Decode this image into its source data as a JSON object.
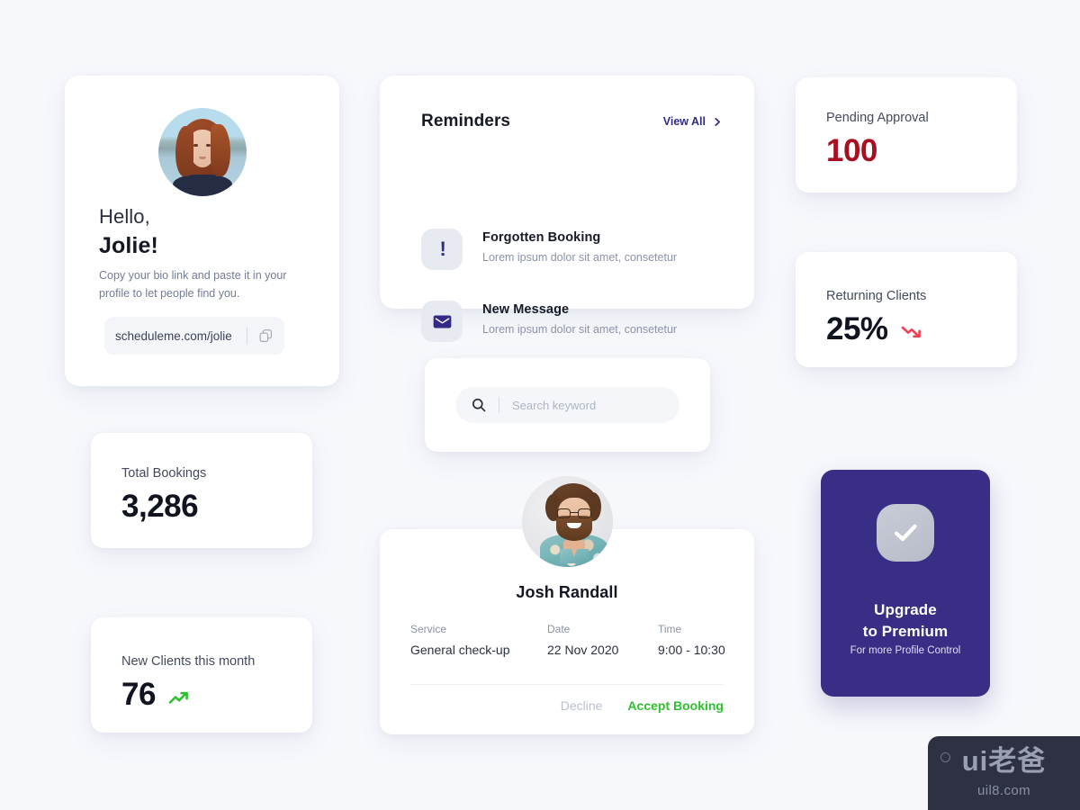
{
  "profile": {
    "greeting": "Hello,",
    "name": "Jolie!",
    "bio": "Copy your bio link and paste it in your profile to let people find you.",
    "link": "scheduleme.com/jolie",
    "copy_icon": "copy-icon",
    "avatar_alt": "Jolie profile photo"
  },
  "reminders": {
    "title": "Reminders",
    "view_all": "View All",
    "chevron_icon": "chevron-right-icon",
    "items": [
      {
        "icon": "exclamation-icon",
        "glyph": "!",
        "title": "Forgotten Booking",
        "subtitle": "Lorem ipsum dolor sit amet, consetetur"
      },
      {
        "icon": "envelope-icon",
        "glyph": "",
        "title": "New Message",
        "subtitle": "Lorem ipsum dolor sit amet, consetetur"
      }
    ]
  },
  "search": {
    "placeholder": "Search keyword",
    "value": "",
    "icon": "search-icon"
  },
  "booking": {
    "name": "Josh Randall",
    "avatar_alt": "Josh Randall profile photo",
    "fields": [
      {
        "label": "Service",
        "value": "General check-up"
      },
      {
        "label": "Date",
        "value": "22 Nov 2020"
      },
      {
        "label": "Time",
        "value": "9:00 - 10:30"
      }
    ],
    "decline_label": "Decline",
    "accept_label": "Accept Booking",
    "accept_color": "#2fc02f",
    "decline_color": "#b9bfcd"
  },
  "stats": {
    "total_bookings": {
      "label": "Total Bookings",
      "value": "3,286",
      "trend": "none",
      "color": "#101420"
    },
    "new_clients": {
      "label": "New Clients this month",
      "value": "76",
      "trend": "up",
      "trend_icon": "trend-up-icon",
      "trend_color": "#2fc02f",
      "color": "#101420"
    },
    "pending_approval": {
      "label": "Pending Approval",
      "value": "100",
      "trend": "none",
      "color": "#a81021"
    },
    "returning_clients": {
      "label": "Returning Clients",
      "value": "25%",
      "trend": "down",
      "trend_icon": "trend-down-icon",
      "trend_color": "#ef4055",
      "color": "#101420"
    }
  },
  "premium": {
    "badge_icon": "check-icon",
    "title_line1": "Upgrade",
    "title_line2": "to Premium",
    "subtitle": "For more Profile Control",
    "background_color": "#382e85"
  },
  "watermark": {
    "logo": "ui老爸",
    "url": "uil8.com"
  },
  "theme": {
    "page_background": "#f7f8fc",
    "card_background": "#ffffff",
    "accent_indigo": "#312b87",
    "accent_green": "#2fc02f",
    "accent_red": "#a81021"
  }
}
